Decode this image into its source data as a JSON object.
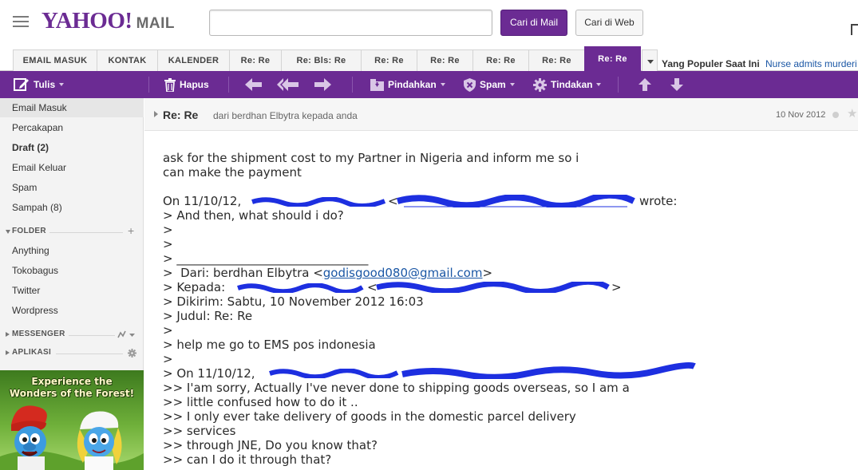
{
  "header": {
    "logo_text": "YAHOO!",
    "logo_mail": "MAIL",
    "search_value": "",
    "search_mail_button": "Cari di Mail",
    "search_web_button": "Cari di Web"
  },
  "tabs": [
    {
      "label": "EMAIL MASUK"
    },
    {
      "label": "KONTAK"
    },
    {
      "label": "KALENDER"
    },
    {
      "label": "Re: Re"
    },
    {
      "label": "Re: Bls: Re"
    },
    {
      "label": "Re: Re"
    },
    {
      "label": "Re: Re"
    },
    {
      "label": "Re: Re"
    },
    {
      "label": "Re: Re"
    },
    {
      "label": "Re: Re",
      "active": true
    }
  ],
  "popular": {
    "label": "Yang Populer Saat Ini",
    "headline": "Nurse admits murderi"
  },
  "toolbar": {
    "compose": "Tulis",
    "delete": "Hapus",
    "move": "Pindahkan",
    "spam": "Spam",
    "actions": "Tindakan"
  },
  "sidebar": {
    "folders": [
      {
        "label": "Email Masuk",
        "active": true
      },
      {
        "label": "Percakapan"
      },
      {
        "label": "Draft (2)",
        "bold": true
      },
      {
        "label": "Email Keluar"
      },
      {
        "label": "Spam"
      },
      {
        "label": "Sampah (8)"
      }
    ],
    "folder_section": "FOLDER",
    "custom_folders": [
      "Anything",
      "Tokobagus",
      "Twitter",
      "Wordpress"
    ],
    "messenger_section": "MESSENGER",
    "apps_section": "APLIKASI"
  },
  "ad": {
    "title_line1": "Experience the",
    "title_line2": "Wonders of the Forest!"
  },
  "message": {
    "subject": "Re: Re",
    "from_line": "dari berdhan Elbytra kepada anda",
    "date": "10 Nov 2012",
    "lines": {
      "l1": "ask for the shipment cost to my Partner in Nigeria and inform me so i",
      "l2": "can make the payment",
      "l3_pre": "On 11/10/12,",
      "l3_post": "wrote:",
      "l4": "> And then, what should i do?",
      "l5": ">",
      "l6": ">",
      "l7": "> ________________________________",
      "l8_pre": ">  Dari: berdhan Elbytra <",
      "l8_link": "godisgood080@gmail.com",
      "l8_post": ">",
      "l9_pre": "> Kepada:",
      "l10": "> Dikirim: Sabtu, 10 November 2012 16:03",
      "l11": "> Judul: Re: Re",
      "l12": ">",
      "l13": "> help me go to EMS pos indonesia",
      "l14": ">",
      "l15_pre": "> On 11/10/12,",
      "l16": ">> I'am sorry, Actually I've never done to shipping goods overseas, so I am a",
      "l17": ">> little confused how to do it ..",
      "l18": ">> I only ever take delivery of goods in the domestic parcel delivery",
      "l19": ">> services",
      "l20": ">> through JNE, Do you know that?",
      "l21": ">> can I do it through that?"
    }
  }
}
